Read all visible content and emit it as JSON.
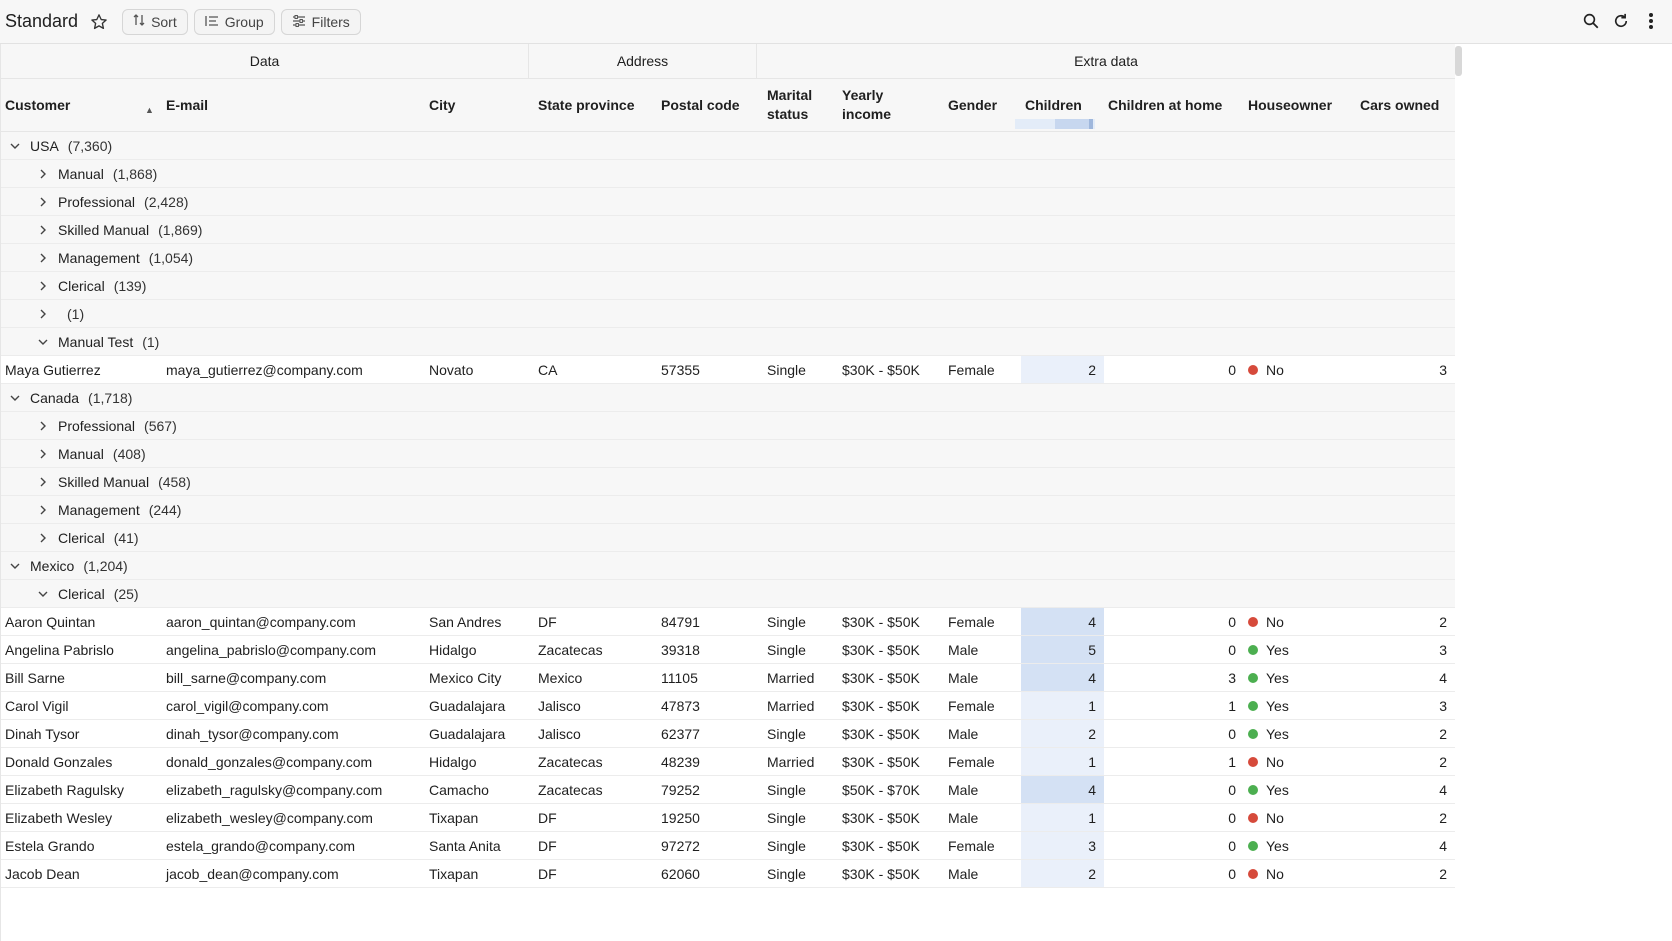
{
  "toolbar": {
    "title": "Standard",
    "sort_label": "Sort",
    "group_label": "Group",
    "filters_label": "Filters"
  },
  "bands": {
    "data": "Data",
    "address": "Address",
    "extra": "Extra data"
  },
  "columns": {
    "customer": "Customer",
    "email": "E-mail",
    "city": "City",
    "state": "State province",
    "postal": "Postal code",
    "marital": "Marital status",
    "income": "Yearly income",
    "gender": "Gender",
    "children": "Children",
    "children_home": "Children at home",
    "houseowner": "Houseowner",
    "cars": "Cars owned"
  },
  "rows": [
    {
      "type": "group",
      "level": 0,
      "expanded": true,
      "label": "USA",
      "count": "(7,360)"
    },
    {
      "type": "group",
      "level": 1,
      "expanded": false,
      "label": "Manual",
      "count": "(1,868)"
    },
    {
      "type": "group",
      "level": 1,
      "expanded": false,
      "label": "Professional",
      "count": "(2,428)"
    },
    {
      "type": "group",
      "level": 1,
      "expanded": false,
      "label": "Skilled Manual",
      "count": "(1,869)"
    },
    {
      "type": "group",
      "level": 1,
      "expanded": false,
      "label": "Management",
      "count": "(1,054)"
    },
    {
      "type": "group",
      "level": 1,
      "expanded": false,
      "label": "Clerical",
      "count": "(139)"
    },
    {
      "type": "group",
      "level": 1,
      "expanded": false,
      "label": "",
      "count": "(1)"
    },
    {
      "type": "group",
      "level": 1,
      "expanded": true,
      "label": "Manual Test",
      "count": "(1)"
    },
    {
      "type": "data",
      "customer": "Maya Gutierrez",
      "email": "maya_gutierrez@company.com",
      "city": "Novato",
      "state": "CA",
      "postal": "57355",
      "marital": "Single",
      "income": "$30K - $50K",
      "gender": "Female",
      "children": "2",
      "children_home": "0",
      "houseowner": "No",
      "cars": "3"
    },
    {
      "type": "group",
      "level": 0,
      "expanded": true,
      "label": "Canada",
      "count": "(1,718)"
    },
    {
      "type": "group",
      "level": 1,
      "expanded": false,
      "label": "Professional",
      "count": "(567)"
    },
    {
      "type": "group",
      "level": 1,
      "expanded": false,
      "label": "Manual",
      "count": "(408)"
    },
    {
      "type": "group",
      "level": 1,
      "expanded": false,
      "label": "Skilled Manual",
      "count": "(458)"
    },
    {
      "type": "group",
      "level": 1,
      "expanded": false,
      "label": "Management",
      "count": "(244)"
    },
    {
      "type": "group",
      "level": 1,
      "expanded": false,
      "label": "Clerical",
      "count": "(41)"
    },
    {
      "type": "group",
      "level": 0,
      "expanded": true,
      "label": "Mexico",
      "count": "(1,204)"
    },
    {
      "type": "group",
      "level": 1,
      "expanded": true,
      "label": "Clerical",
      "count": "(25)"
    },
    {
      "type": "data",
      "customer": "Aaron Quintan",
      "email": "aaron_quintan@company.com",
      "city": "San Andres",
      "state": "DF",
      "postal": "84791",
      "marital": "Single",
      "income": "$30K - $50K",
      "gender": "Female",
      "children": "4",
      "children_home": "0",
      "houseowner": "No",
      "cars": "2"
    },
    {
      "type": "data",
      "customer": "Angelina Pabrislo",
      "email": "angelina_pabrislo@company.com",
      "city": "Hidalgo",
      "state": "Zacatecas",
      "postal": "39318",
      "marital": "Single",
      "income": "$30K - $50K",
      "gender": "Male",
      "children": "5",
      "children_home": "0",
      "houseowner": "Yes",
      "cars": "3"
    },
    {
      "type": "data",
      "customer": "Bill Sarne",
      "email": "bill_sarne@company.com",
      "city": "Mexico City",
      "state": "Mexico",
      "postal": "11105",
      "marital": "Married",
      "income": "$30K - $50K",
      "gender": "Male",
      "children": "4",
      "children_home": "3",
      "houseowner": "Yes",
      "cars": "4"
    },
    {
      "type": "data",
      "customer": "Carol Vigil",
      "email": "carol_vigil@company.com",
      "city": "Guadalajara",
      "state": "Jalisco",
      "postal": "47873",
      "marital": "Married",
      "income": "$30K - $50K",
      "gender": "Female",
      "children": "1",
      "children_home": "1",
      "houseowner": "Yes",
      "cars": "3"
    },
    {
      "type": "data",
      "customer": "Dinah Tysor",
      "email": "dinah_tysor@company.com",
      "city": "Guadalajara",
      "state": "Jalisco",
      "postal": "62377",
      "marital": "Single",
      "income": "$30K - $50K",
      "gender": "Male",
      "children": "2",
      "children_home": "0",
      "houseowner": "Yes",
      "cars": "2"
    },
    {
      "type": "data",
      "customer": "Donald Gonzales",
      "email": "donald_gonzales@company.com",
      "city": "Hidalgo",
      "state": "Zacatecas",
      "postal": "48239",
      "marital": "Married",
      "income": "$30K - $50K",
      "gender": "Female",
      "children": "1",
      "children_home": "1",
      "houseowner": "No",
      "cars": "2"
    },
    {
      "type": "data",
      "customer": "Elizabeth Ragulsky",
      "email": "elizabeth_ragulsky@company.com",
      "city": "Camacho",
      "state": "Zacatecas",
      "postal": "79252",
      "marital": "Single",
      "income": "$50K - $70K",
      "gender": "Male",
      "children": "4",
      "children_home": "0",
      "houseowner": "Yes",
      "cars": "4"
    },
    {
      "type": "data",
      "customer": "Elizabeth Wesley",
      "email": "elizabeth_wesley@company.com",
      "city": "Tixapan",
      "state": "DF",
      "postal": "19250",
      "marital": "Single",
      "income": "$30K - $50K",
      "gender": "Male",
      "children": "1",
      "children_home": "0",
      "houseowner": "No",
      "cars": "2"
    },
    {
      "type": "data",
      "customer": "Estela Grando",
      "email": "estela_grando@company.com",
      "city": "Santa Anita",
      "state": "DF",
      "postal": "97272",
      "marital": "Single",
      "income": "$30K - $50K",
      "gender": "Female",
      "children": "3",
      "children_home": "0",
      "houseowner": "Yes",
      "cars": "4"
    },
    {
      "type": "data",
      "customer": "Jacob Dean",
      "email": "jacob_dean@company.com",
      "city": "Tixapan",
      "state": "DF",
      "postal": "62060",
      "marital": "Single",
      "income": "$30K - $50K",
      "gender": "Male",
      "children": "2",
      "children_home": "0",
      "houseowner": "No",
      "cars": "2"
    }
  ],
  "colors": {
    "yes": "#4caf50",
    "no": "#d64a3b",
    "children_highlight": "#d4e1f4"
  },
  "icons": {
    "star": "star-icon",
    "sort": "sort-icon",
    "group": "group-icon",
    "filters": "filters-icon",
    "search": "search-icon",
    "refresh": "refresh-icon",
    "more": "more-vert-icon"
  }
}
